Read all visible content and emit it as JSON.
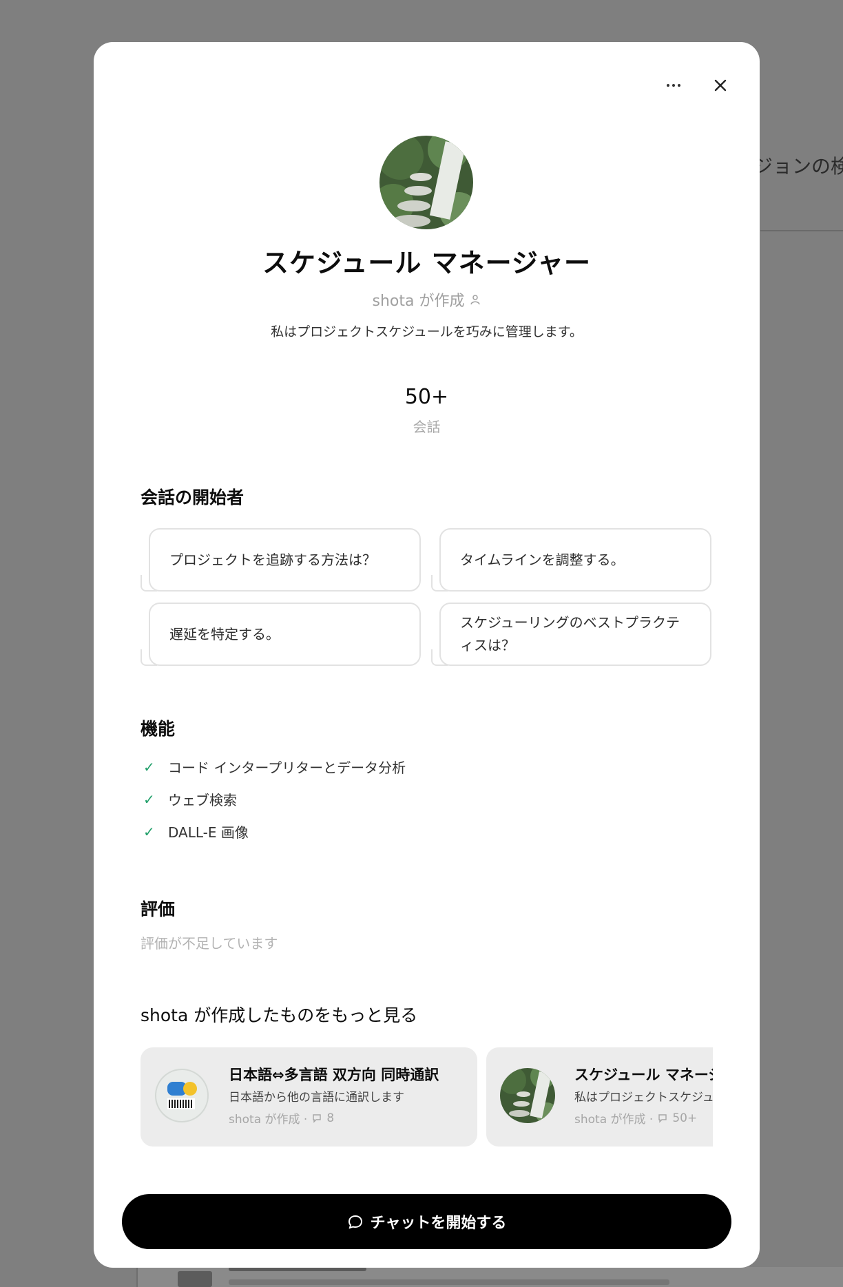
{
  "background": {
    "partial_text": "ジョンの検索"
  },
  "modal": {
    "title": "スケジュール マネージャー",
    "creator": "shota が作成",
    "description": "私はプロジェクトスケジュールを巧みに管理します。",
    "stats": {
      "value": "50+",
      "label": "会話"
    },
    "starters": {
      "heading": "会話の開始者",
      "items": [
        {
          "label": "プロジェクトを追跡する方法は？"
        },
        {
          "label": "タイムラインを調整する。"
        },
        {
          "label": "遅延を特定する。"
        },
        {
          "label": "スケジューリングのベストプラクティスは？"
        }
      ]
    },
    "capabilities": {
      "heading": "機能",
      "items": [
        {
          "label": "コード インタープリターとデータ分析"
        },
        {
          "label": "ウェブ検索"
        },
        {
          "label": "DALL-E 画像"
        }
      ]
    },
    "rating": {
      "heading": "評価",
      "subtext": "評価が不足しています"
    },
    "more": {
      "heading": "shota が作成したものをもっと見る",
      "cards": [
        {
          "title": "日本語⇔多言語 双方向 同時通訳",
          "description": "日本語から他の言語に通訳します",
          "meta_creator": "shota が作成 ·",
          "meta_count": "8"
        },
        {
          "title": "スケジュール マネージャー",
          "description": "私はプロジェクトスケジュールを巧みに管理します。",
          "meta_creator": "shota が作成 ·",
          "meta_count": "50+"
        }
      ]
    },
    "chat_button": "チャットを開始する"
  },
  "colors": {
    "backdrop": "#7f7f7f",
    "check": "#22a06b",
    "button_bg": "#000000",
    "card_bg": "#ececec"
  }
}
